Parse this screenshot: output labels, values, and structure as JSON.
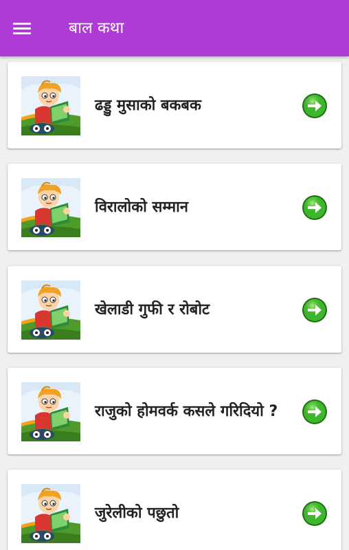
{
  "appbar": {
    "menu_icon": "hamburger-menu-icon",
    "title": "बाल कथा",
    "background": "#b03ad6"
  },
  "stories": [
    {
      "title": "ढड्डु मुसाको बकबक",
      "thumbnail_icon": "boy-reading-book-icon",
      "action_icon": "arrow-right-circle-icon"
    },
    {
      "title": "विरालोको सम्मान",
      "thumbnail_icon": "boy-reading-book-icon",
      "action_icon": "arrow-right-circle-icon"
    },
    {
      "title": "खेलाडी गुफी र रोबोट",
      "thumbnail_icon": "boy-reading-book-icon",
      "action_icon": "arrow-right-circle-icon"
    },
    {
      "title": "राजुको होमवर्क कसले गरिदियो ?",
      "thumbnail_icon": "boy-reading-book-icon",
      "action_icon": "arrow-right-circle-icon"
    },
    {
      "title": "जुरेलीको पछुतो",
      "thumbnail_icon": "boy-reading-book-icon",
      "action_icon": "arrow-right-circle-icon"
    }
  ],
  "colors": {
    "accent": "#b03ad6",
    "arrow_green": "#3db52c",
    "background": "#f0f0f0"
  }
}
